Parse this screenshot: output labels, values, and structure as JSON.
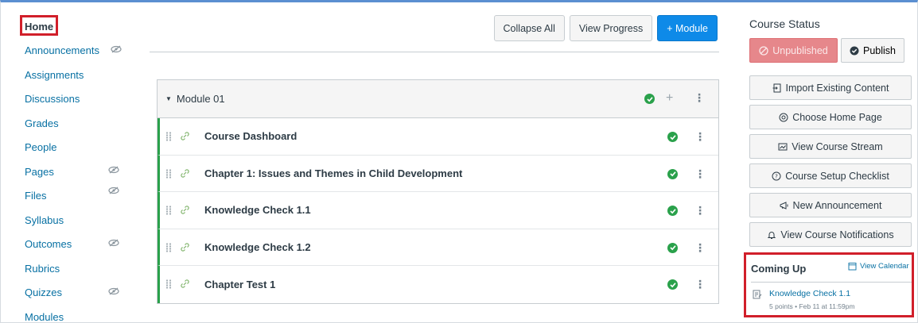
{
  "nav": {
    "items": [
      {
        "label": "Home"
      },
      {
        "label": "Announcements"
      },
      {
        "label": "Assignments"
      },
      {
        "label": "Discussions"
      },
      {
        "label": "Grades"
      },
      {
        "label": "People"
      },
      {
        "label": "Pages"
      },
      {
        "label": "Files"
      },
      {
        "label": "Syllabus"
      },
      {
        "label": "Outcomes"
      },
      {
        "label": "Rubrics"
      },
      {
        "label": "Quizzes"
      },
      {
        "label": "Modules"
      }
    ]
  },
  "toolbar": {
    "collapse_all": "Collapse All",
    "view_progress": "View Progress",
    "add_module": "+ Module"
  },
  "module": {
    "title": "Module 01",
    "items": [
      {
        "title": "Course Dashboard"
      },
      {
        "title": "Chapter 1: Issues and Themes in Child Development"
      },
      {
        "title": "Knowledge Check 1.1"
      },
      {
        "title": "Knowledge Check 1.2"
      },
      {
        "title": "Chapter Test 1"
      }
    ]
  },
  "sidebar": {
    "status_title": "Course Status",
    "unpublished": "Unpublished",
    "publish": "Publish",
    "actions": [
      {
        "label": "Import Existing Content",
        "icon": "import-icon"
      },
      {
        "label": "Choose Home Page",
        "icon": "home-page-icon"
      },
      {
        "label": "View Course Stream",
        "icon": "stream-icon"
      },
      {
        "label": "Course Setup Checklist",
        "icon": "checklist-icon"
      },
      {
        "label": "New Announcement",
        "icon": "announcement-icon"
      },
      {
        "label": "View Course Notifications",
        "icon": "bell-icon"
      }
    ],
    "coming_up": {
      "title": "Coming Up",
      "view_calendar": "View Calendar",
      "event_title": "Knowledge Check 1.1",
      "event_meta": "5 points • Feb 11 at 11:59pm"
    }
  },
  "colors": {
    "link": "#0770a3",
    "primary": "#0e8ae8",
    "success": "#2aa14b",
    "unpublished": "#e6878b",
    "highlight": "#d11f2a"
  }
}
